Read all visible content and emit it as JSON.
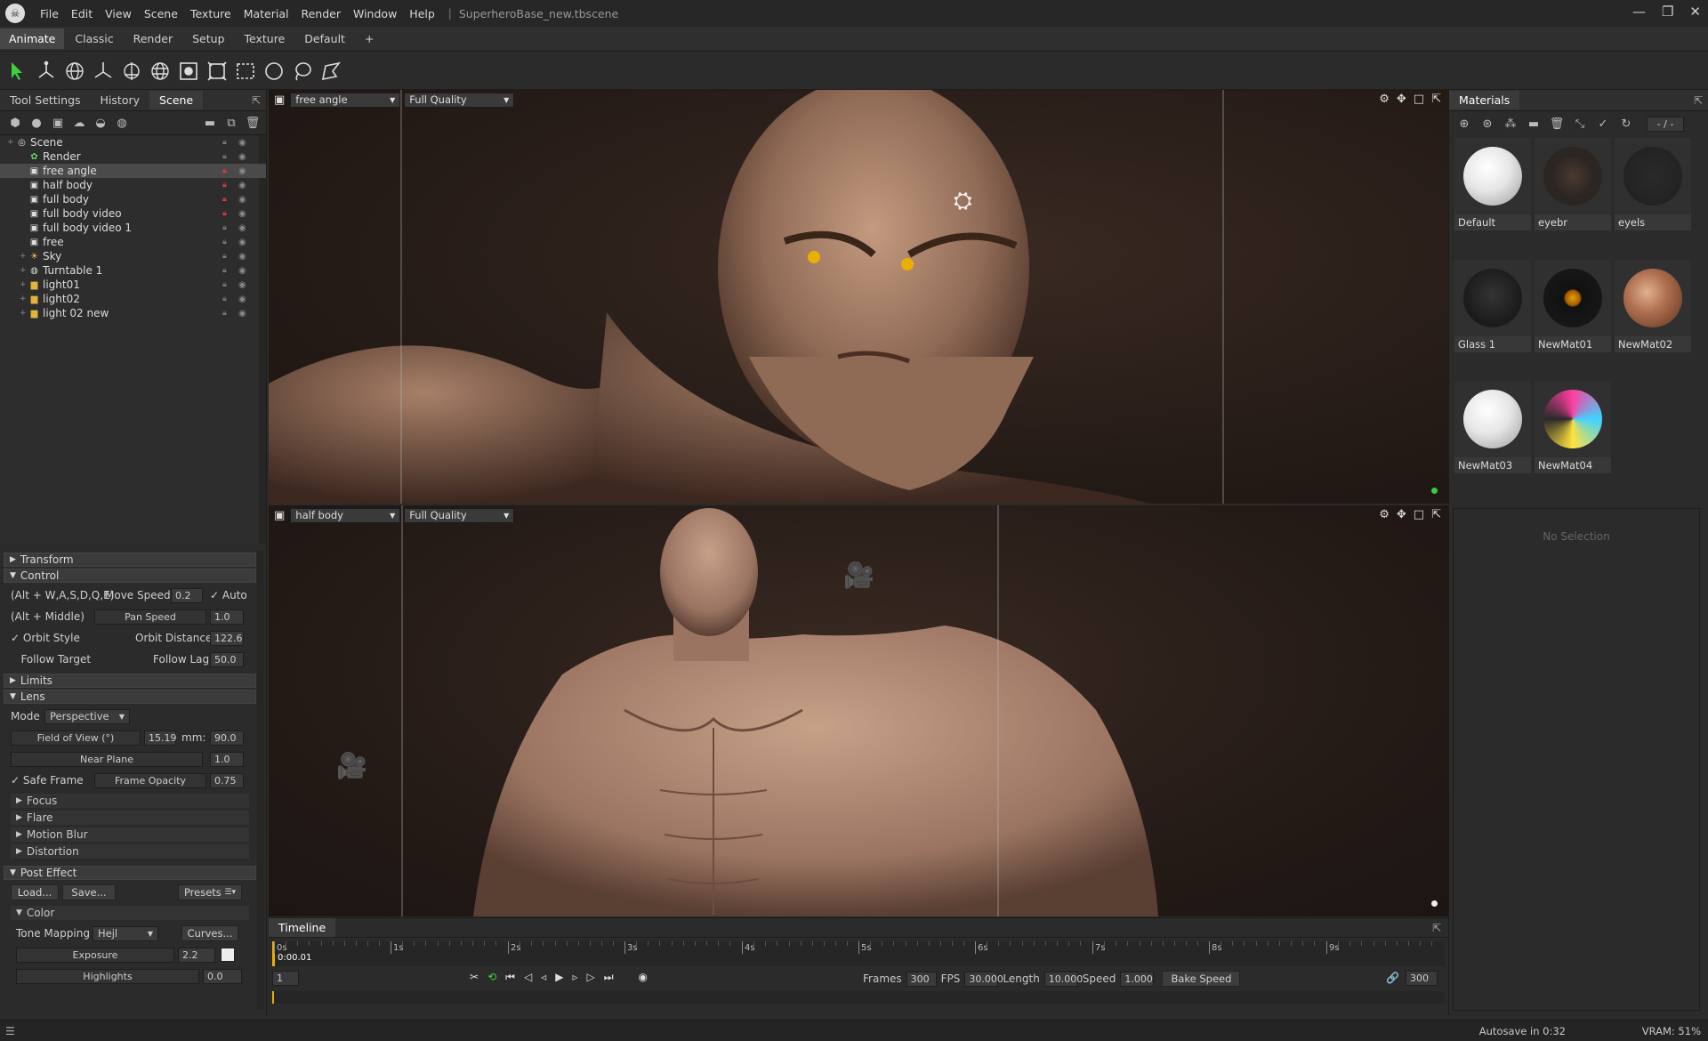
{
  "app": {
    "title": "SuperheroBase_new.tbscene",
    "menu": [
      "File",
      "Edit",
      "View",
      "Scene",
      "Texture",
      "Material",
      "Render",
      "Window",
      "Help"
    ]
  },
  "layouts": {
    "tabs": [
      "Animate",
      "Classic",
      "Render",
      "Setup",
      "Texture",
      "Default"
    ],
    "add": "+",
    "active": "Animate"
  },
  "left_panel": {
    "tabs": [
      "Tool Settings",
      "History",
      "Scene"
    ],
    "active_tab": "Scene",
    "tree": [
      {
        "label": "Scene",
        "icon": "scene-icon",
        "indent": 0,
        "lock": "gray",
        "selected": false
      },
      {
        "label": "Render",
        "icon": "render-icon",
        "indent": 1,
        "lock": "gray",
        "selected": false
      },
      {
        "label": "free angle",
        "icon": "camera-icon",
        "indent": 1,
        "lock": "red",
        "selected": true
      },
      {
        "label": "half body",
        "icon": "camera-icon",
        "indent": 1,
        "lock": "red",
        "selected": false
      },
      {
        "label": "full body",
        "icon": "camera-icon",
        "indent": 1,
        "lock": "red",
        "selected": false
      },
      {
        "label": "full body video",
        "icon": "camera-icon",
        "indent": 1,
        "lock": "red",
        "selected": false
      },
      {
        "label": "full body video 1",
        "icon": "camera-icon",
        "indent": 1,
        "lock": "gray",
        "selected": false
      },
      {
        "label": "free",
        "icon": "camera-icon",
        "indent": 1,
        "lock": "gray",
        "selected": false
      },
      {
        "label": "Sky",
        "icon": "sky-icon",
        "indent": 1,
        "lock": "gray",
        "selected": false
      },
      {
        "label": "Turntable 1",
        "icon": "turntable-icon",
        "indent": 1,
        "lock": "gray",
        "selected": false
      },
      {
        "label": "light01",
        "icon": "folder-icon",
        "indent": 1,
        "lock": "gray",
        "selected": false
      },
      {
        "label": "light02",
        "icon": "folder-icon",
        "indent": 1,
        "lock": "gray",
        "selected": false
      },
      {
        "label": "light 02 new",
        "icon": "folder-icon",
        "indent": 1,
        "lock": "gray",
        "selected": false
      }
    ],
    "sections": {
      "transform": "Transform",
      "control": "Control",
      "limits": "Limits",
      "lens": "Lens",
      "post_effect": "Post Effect",
      "focus": "Focus",
      "flare": "Flare",
      "motion_blur": "Motion Blur",
      "distortion": "Distortion",
      "color": "Color"
    },
    "control": {
      "move_hint": "(Alt + W,A,S,D,Q,E)",
      "move_speed_label": "Move Speed:",
      "move_speed": "0.2",
      "auto_label": "Auto",
      "pan_hint": "(Alt + Middle)",
      "pan_speed_label": "Pan Speed",
      "pan_speed": "1.0",
      "orbit_style_label": "Orbit Style",
      "orbit_distance_label": "Orbit Distance:",
      "orbit_distance": "122.6",
      "follow_target_label": "Follow Target",
      "follow_lag_label": "Follow Lag",
      "follow_lag": "50.0"
    },
    "lens": {
      "mode_label": "Mode",
      "mode": "Perspective",
      "fov_label": "Field of View (°)",
      "fov": "15.19",
      "mm_label": "mm:",
      "mm": "90.0",
      "near_plane_label": "Near Plane",
      "near_plane": "1.0",
      "safe_frame_label": "Safe Frame",
      "frame_opacity_label": "Frame Opacity",
      "frame_opacity": "0.75"
    },
    "post": {
      "load": "Load...",
      "save": "Save...",
      "presets": "Presets",
      "tone_mapping_label": "Tone Mapping",
      "tone_mapping": "Hejl",
      "curves": "Curves...",
      "exposure_label": "Exposure",
      "exposure": "2.2",
      "highlights_label": "Highlights",
      "highlights": "0.0"
    }
  },
  "viewport_top": {
    "camera": "free angle",
    "quality": "Full Quality"
  },
  "viewport_bottom": {
    "camera": "half body",
    "quality": "Full Quality"
  },
  "materials": {
    "title": "Materials",
    "counter": "- / -",
    "items": [
      {
        "name": "Default",
        "swatch": "white-sphere"
      },
      {
        "name": "eyebr",
        "swatch": "eyebrow"
      },
      {
        "name": "eyels",
        "swatch": "eyelash"
      },
      {
        "name": "Glass 1",
        "swatch": "glass"
      },
      {
        "name": "NewMat01",
        "swatch": "eye"
      },
      {
        "name": "NewMat02",
        "swatch": "skin"
      },
      {
        "name": "NewMat03",
        "swatch": "white-sphere"
      },
      {
        "name": "NewMat04",
        "swatch": "colorful"
      }
    ],
    "no_selection": "No Selection"
  },
  "timeline": {
    "title": "Timeline",
    "ticks": [
      "0s",
      "1s",
      "2s",
      "3s",
      "4s",
      "5s",
      "6s",
      "7s",
      "8s",
      "9s"
    ],
    "current_time": "0:00.01",
    "current_frame": "1",
    "frames_label": "Frames",
    "frames": "300",
    "fps_label": "FPS",
    "fps": "30.000",
    "length_label": "Length",
    "length": "10.000",
    "speed_label": "Speed",
    "speed": "1.000",
    "bake_speed": "Bake Speed",
    "end_frame": "300"
  },
  "status": {
    "autosave": "Autosave in 0:32",
    "vram": "VRAM: 51%"
  },
  "colors": {
    "accent": "#e8b000",
    "lock_red": "#e03a3a",
    "viewport_bg": "#231b18",
    "skin": "#b98b73"
  }
}
